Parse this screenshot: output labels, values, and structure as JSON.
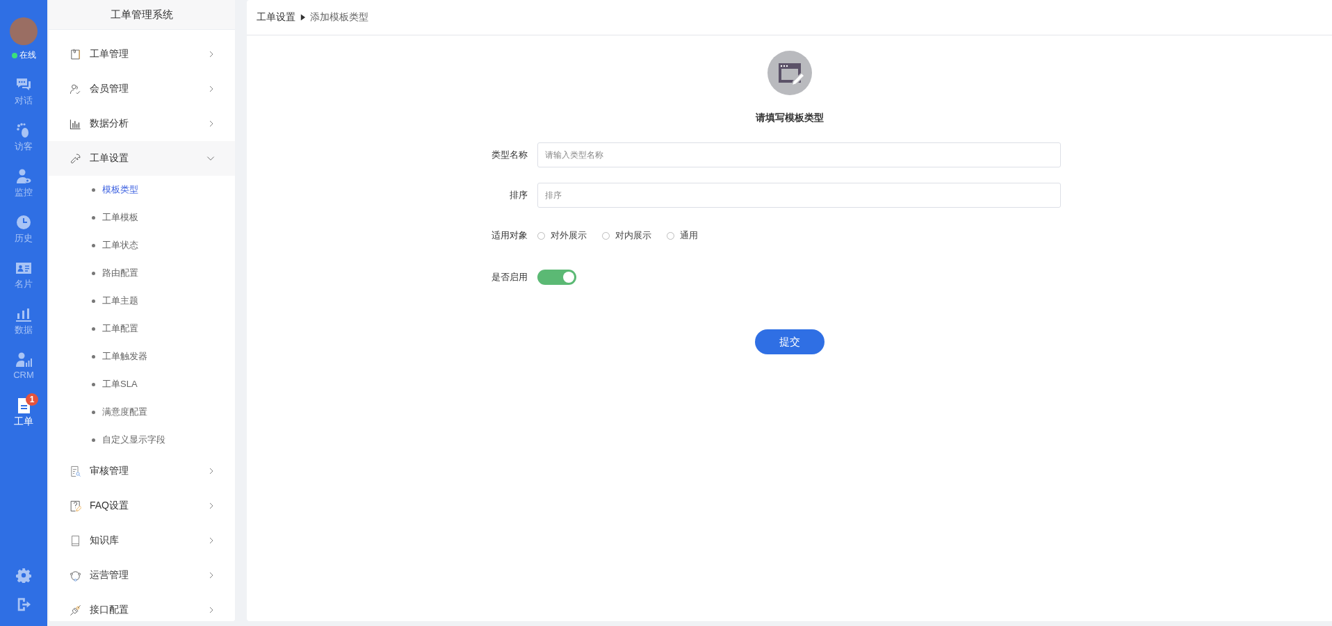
{
  "rail": {
    "status": "在线",
    "online": true,
    "items": [
      {
        "kind": "chat",
        "label": "对话",
        "selected": false
      },
      {
        "kind": "visitor",
        "label": "访客",
        "selected": false
      },
      {
        "kind": "monitor",
        "label": "监控",
        "selected": false
      },
      {
        "kind": "history",
        "label": "历史",
        "selected": false
      },
      {
        "kind": "card",
        "label": "名片",
        "selected": false
      },
      {
        "kind": "data",
        "label": "数据",
        "selected": false
      },
      {
        "kind": "crm",
        "label": "CRM",
        "selected": false
      },
      {
        "kind": "ticket",
        "label": "工单",
        "selected": true,
        "badge": "1"
      }
    ]
  },
  "sidebar": {
    "title": "工单管理系统",
    "items": [
      {
        "kind": "ticket",
        "label": "工单管理",
        "expanded": false
      },
      {
        "kind": "members",
        "label": "会员管理",
        "expanded": false
      },
      {
        "kind": "chart",
        "label": "数据分析",
        "expanded": false
      },
      {
        "kind": "wrench",
        "label": "工单设置",
        "expanded": true,
        "children": [
          {
            "label": "模板类型",
            "selected": true
          },
          {
            "label": "工单模板",
            "selected": false
          },
          {
            "label": "工单状态",
            "selected": false
          },
          {
            "label": "路由配置",
            "selected": false
          },
          {
            "label": "工单主题",
            "selected": false
          },
          {
            "label": "工单配置",
            "selected": false
          },
          {
            "label": "工单触发器",
            "selected": false
          },
          {
            "label": "工单SLA",
            "selected": false
          },
          {
            "label": "满意度配置",
            "selected": false
          },
          {
            "label": "自定义显示字段",
            "selected": false
          }
        ]
      },
      {
        "kind": "audit",
        "label": "审核管理",
        "expanded": false
      },
      {
        "kind": "faq",
        "label": "FAQ设置",
        "expanded": false
      },
      {
        "kind": "book",
        "label": "知识库",
        "expanded": false
      },
      {
        "kind": "ops",
        "label": "运营管理",
        "expanded": false
      },
      {
        "kind": "plug",
        "label": "接口配置",
        "expanded": false
      }
    ]
  },
  "breadcrumb": [
    "工单设置",
    "添加模板类型"
  ],
  "form": {
    "heading": "请填写模板类型",
    "fields": [
      {
        "kind": "text",
        "label": "类型名称",
        "placeholder": "请输入类型名称"
      },
      {
        "kind": "text",
        "label": "排序",
        "placeholder": "排序"
      },
      {
        "kind": "radio",
        "label": "适用对象",
        "options": [
          {
            "label": "对外展示",
            "selected": false
          },
          {
            "label": "对内展示",
            "selected": false
          },
          {
            "label": "通用",
            "selected": false
          }
        ]
      },
      {
        "kind": "switch",
        "label": "是否启用",
        "on": true
      }
    ],
    "submit": "提交"
  }
}
